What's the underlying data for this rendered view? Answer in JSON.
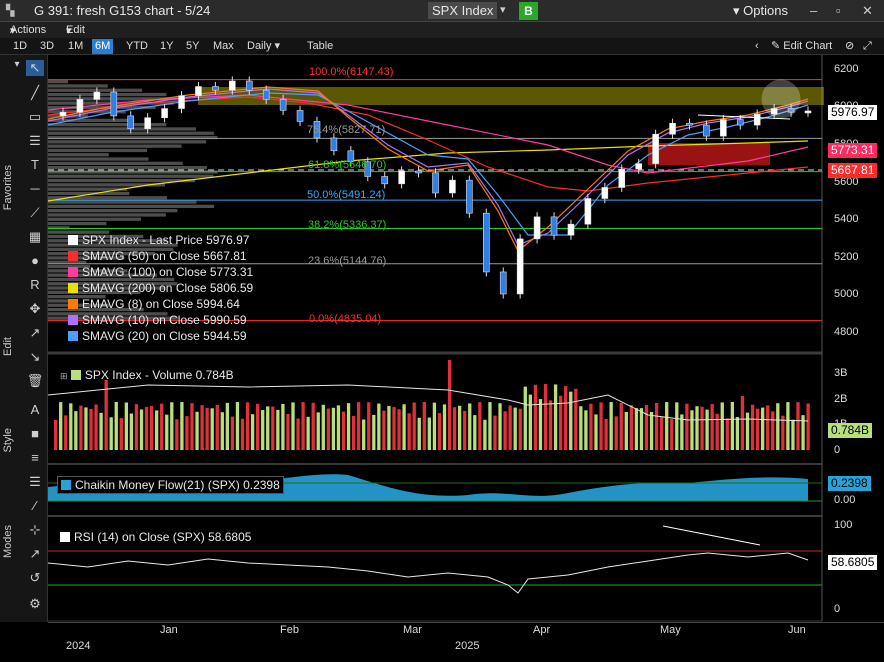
{
  "window": {
    "title": "G 391: fresh G153 chart - 5/24",
    "ticker": "SPX Index",
    "badge": "B",
    "options": "Options",
    "caret": "▾",
    "badge_color": "#2aa82a"
  },
  "menu": {
    "actions": "Actions",
    "edit": "Edit"
  },
  "ranges": {
    "items": [
      "1D",
      "3D",
      "1M",
      "6M",
      "YTD",
      "1Y",
      "5Y",
      "Max"
    ],
    "selected": "6M",
    "period": "Daily",
    "table": "Table",
    "edit_chart": "Edit Chart"
  },
  "sidebar": {
    "favorites": "Favorites",
    "edit": "Edit",
    "style": "Style",
    "modes": "Modes"
  },
  "legend_main": [
    {
      "label": "SPX Index - Last Price",
      "value": "5976.97",
      "color": "#ffffff"
    },
    {
      "label": "SMAVG (50)  on Close",
      "value": "5667.81",
      "color": "#ff2a2a"
    },
    {
      "label": "SMAVG (100)  on Close",
      "value": "5773.31",
      "color": "#ff3aa0"
    },
    {
      "label": "SMAVG (200)  on Close",
      "value": "5806.59",
      "color": "#e8e000"
    },
    {
      "label": "EMAVG (8)  on Close",
      "value": "5994.64",
      "color": "#ff7a00"
    },
    {
      "label": "SMAVG (10)  on Close",
      "value": "5990.59",
      "color": "#b070ff"
    },
    {
      "label": "SMAVG (20)  on Close",
      "value": "5944.59",
      "color": "#4aa0ff"
    }
  ],
  "fib_levels": [
    {
      "label": "100.0%(6147.43)",
      "value": 6147.43,
      "color": "#ff3030"
    },
    {
      "label": "76.4%(5827.71)",
      "value": 5827.71,
      "color": "#999999"
    },
    {
      "label": "61.8%(5646.70)",
      "value": 5646.7,
      "color": "#22cc22"
    },
    {
      "label": "50.0%(5491.24)",
      "value": 5491.24,
      "color": "#33aaff"
    },
    {
      "label": "38.2%(5336.37)",
      "value": 5336.37,
      "color": "#22cc22"
    },
    {
      "label": "23.6%(5144.76)",
      "value": 5144.76,
      "color": "#999999"
    },
    {
      "label": "0.0%(4835.04)",
      "value": 4835.04,
      "color": "#ff3030"
    }
  ],
  "price_axis": [
    "6200",
    "6000",
    "5800",
    "5600",
    "5400",
    "5200",
    "5000",
    "4800"
  ],
  "price_tags": [
    {
      "text": "5976.97",
      "bg": "#ffffff",
      "fg": "#000000"
    },
    {
      "text": "5773.31",
      "bg": "#ff2a60",
      "fg": "#ffffff"
    },
    {
      "text": "5667.81",
      "bg": "#ff2a2a",
      "fg": "#ffffff"
    }
  ],
  "volume": {
    "legend": "SPX Index - Volume",
    "value": "0.784B",
    "axis": [
      "3B",
      "2B",
      "1B",
      "0"
    ],
    "tag": "0.784B"
  },
  "cmf": {
    "legend": "Chaikin Money Flow(21) (SPX)",
    "value": "0.2398",
    "tag": "0.2398",
    "axis": [
      "0.00"
    ]
  },
  "rsi": {
    "legend": "RSI (14)  on Close (SPX)",
    "value": "58.6805",
    "tag": "58.6805",
    "axis": [
      "100",
      "50",
      "0"
    ]
  },
  "time_axis": {
    "months": [
      "Jan",
      "Feb",
      "Mar",
      "Apr",
      "May",
      "Jun"
    ],
    "years": [
      "2024",
      "2025"
    ]
  },
  "chart_data": {
    "type": "line",
    "ylim": [
      4800,
      6250
    ],
    "series": [
      {
        "name": "SPX Index - Last Price",
        "values": [
          5970,
          6040,
          6080,
          5950,
          5880,
          5940,
          5990,
          6060,
          6110,
          6090,
          6140,
          6090,
          6040,
          5980,
          5920,
          5830,
          5760,
          5700,
          5620,
          5580,
          5650,
          5640,
          5530,
          5600,
          5420,
          5100,
          4980,
          5280,
          5400,
          5300,
          5360,
          5500,
          5560,
          5660,
          5690,
          5850,
          5910,
          5900,
          5840,
          5930,
          5900,
          5960,
          5990,
          5970,
          5977
        ]
      }
    ]
  }
}
